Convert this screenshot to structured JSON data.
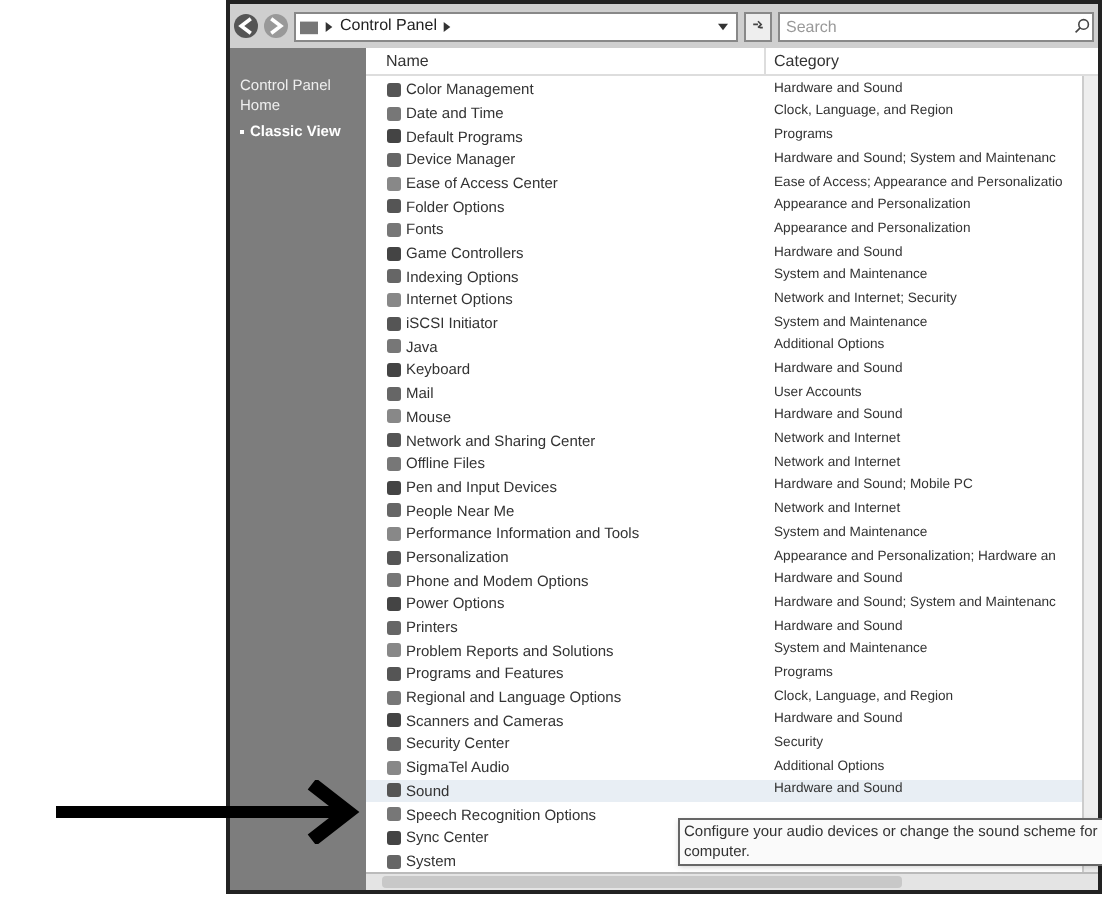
{
  "address_bar": {
    "breadcrumb": "Control Panel",
    "search_placeholder": "Search"
  },
  "sidebar": {
    "items": [
      {
        "label": "Control Panel Home",
        "selected": false
      },
      {
        "label": "Classic View",
        "selected": true
      }
    ]
  },
  "table": {
    "columns": [
      "Name",
      "Category"
    ],
    "rows": [
      {
        "name": "Color Management",
        "category": "Hardware and Sound",
        "selected": false
      },
      {
        "name": "Date and Time",
        "category": "Clock, Language, and Region",
        "selected": false
      },
      {
        "name": "Default Programs",
        "category": "Programs",
        "selected": false
      },
      {
        "name": "Device Manager",
        "category": "Hardware and Sound; System and Maintenanc",
        "selected": false
      },
      {
        "name": "Ease of Access Center",
        "category": "Ease of Access; Appearance and Personalizatio",
        "selected": false
      },
      {
        "name": "Folder Options",
        "category": "Appearance and Personalization",
        "selected": false
      },
      {
        "name": "Fonts",
        "category": "Appearance and Personalization",
        "selected": false
      },
      {
        "name": "Game Controllers",
        "category": "Hardware and Sound",
        "selected": false
      },
      {
        "name": "Indexing Options",
        "category": "System and Maintenance",
        "selected": false
      },
      {
        "name": "Internet Options",
        "category": "Network and Internet; Security",
        "selected": false
      },
      {
        "name": "iSCSI Initiator",
        "category": "System and Maintenance",
        "selected": false
      },
      {
        "name": "Java",
        "category": "Additional Options",
        "selected": false
      },
      {
        "name": "Keyboard",
        "category": "Hardware and Sound",
        "selected": false
      },
      {
        "name": "Mail",
        "category": "User Accounts",
        "selected": false
      },
      {
        "name": "Mouse",
        "category": "Hardware and Sound",
        "selected": false
      },
      {
        "name": "Network and Sharing Center",
        "category": "Network and Internet",
        "selected": false
      },
      {
        "name": "Offline Files",
        "category": "Network and Internet",
        "selected": false
      },
      {
        "name": "Pen and Input Devices",
        "category": "Hardware and Sound; Mobile PC",
        "selected": false
      },
      {
        "name": "People Near Me",
        "category": "Network and Internet",
        "selected": false
      },
      {
        "name": "Performance Information and Tools",
        "category": "System and Maintenance",
        "selected": false
      },
      {
        "name": "Personalization",
        "category": "Appearance and Personalization; Hardware an",
        "selected": false
      },
      {
        "name": "Phone and Modem Options",
        "category": "Hardware and Sound",
        "selected": false
      },
      {
        "name": "Power Options",
        "category": "Hardware and Sound; System and Maintenanc",
        "selected": false
      },
      {
        "name": "Printers",
        "category": "Hardware and Sound",
        "selected": false
      },
      {
        "name": "Problem Reports and Solutions",
        "category": "System and Maintenance",
        "selected": false
      },
      {
        "name": "Programs and Features",
        "category": "Programs",
        "selected": false
      },
      {
        "name": "Regional and Language Options",
        "category": "Clock, Language, and Region",
        "selected": false
      },
      {
        "name": "Scanners and Cameras",
        "category": "Hardware and Sound",
        "selected": false
      },
      {
        "name": "Security Center",
        "category": "Security",
        "selected": false
      },
      {
        "name": "SigmaTel Audio",
        "category": "Additional Options",
        "selected": false
      },
      {
        "name": "Sound",
        "category": "Hardware and Sound",
        "selected": true
      },
      {
        "name": "Speech Recognition Options",
        "selected": false
      },
      {
        "name": "Sync Center",
        "selected": false
      },
      {
        "name": "System",
        "selected": false
      }
    ]
  },
  "tooltip": {
    "text": "Configure your audio devices or change the sound scheme for computer."
  }
}
